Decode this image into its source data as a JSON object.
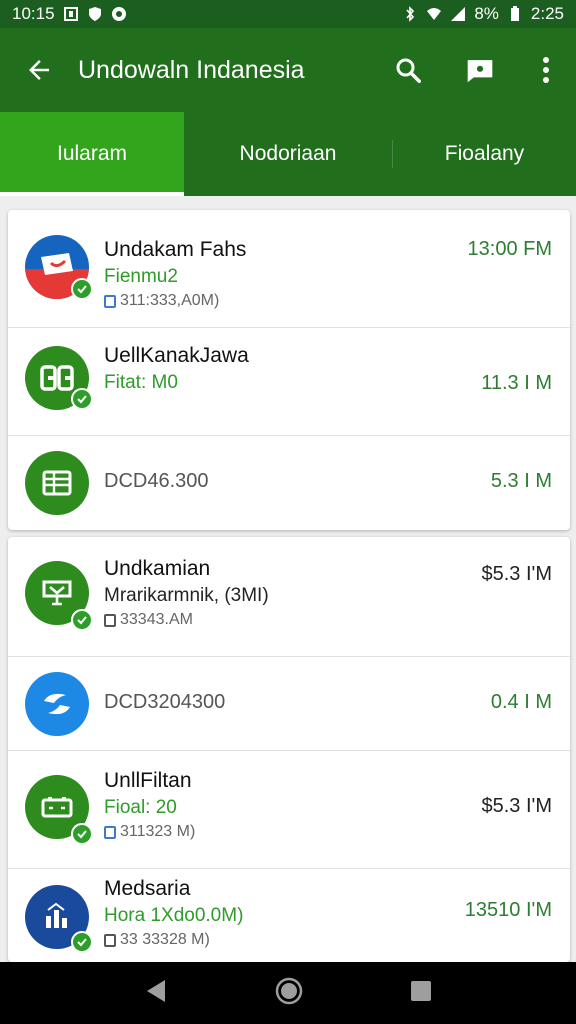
{
  "status_bar": {
    "time": "10:15",
    "battery": "8%",
    "clock_right": "2:25"
  },
  "app_bar": {
    "title": "Undowaln Indanesia",
    "icons": [
      "back-arrow-icon",
      "search-icon",
      "chat-icon",
      "more-vert-icon"
    ]
  },
  "tabs": [
    {
      "label": "Iularam",
      "active": true
    },
    {
      "label": "Nodoriaan",
      "active": false
    },
    {
      "label": "Fioalany",
      "active": false
    }
  ],
  "list_group_1": [
    {
      "name": "Undakam Fahs",
      "sub": "Fienmu2",
      "meta": "311:333,A0M)",
      "value": "13:00 FM",
      "icon": "flag-icon",
      "color": "#1565c0"
    },
    {
      "name": "UellKanakJawa",
      "sub": "Fitat: M0",
      "meta": "",
      "value": "11.3 I M",
      "icon": "gg-logo-icon",
      "color": "#2e8b1e"
    },
    {
      "name": "",
      "plain": "DCD46.300",
      "value": "5.3 I M",
      "icon": "spreadsheet-icon",
      "color": "#2e8b1e"
    }
  ],
  "list_group_2": [
    {
      "name": "Undkamian",
      "sub": "Mrarikarmnik, (3MI)",
      "meta": "33343.AM",
      "value": "$5.3 I'M",
      "icon": "cart-icon",
      "color": "#2e8b1e"
    },
    {
      "name": "",
      "plain": "DCD3204300",
      "value": "0.4 I M",
      "icon": "swirl-icon",
      "color": "#1e88e5"
    },
    {
      "name": "UnllFiltan",
      "sub": "Fioal: 20",
      "meta": "311323 M)",
      "value": "$5.3 I'M",
      "icon": "battery-icon",
      "color": "#2e8b1e"
    },
    {
      "name": "Medsaria",
      "sub": "Hora 1Xdo0.0M)",
      "meta": "33 33328 M)",
      "value": "13510 I'M",
      "icon": "chart-icon",
      "color": "#1a4a9c"
    }
  ],
  "colors": {
    "app_bar": "#216e1d",
    "status_bar": "#1b5e20",
    "active_tab": "#33a51d",
    "accent_green": "#2e9e2a"
  }
}
